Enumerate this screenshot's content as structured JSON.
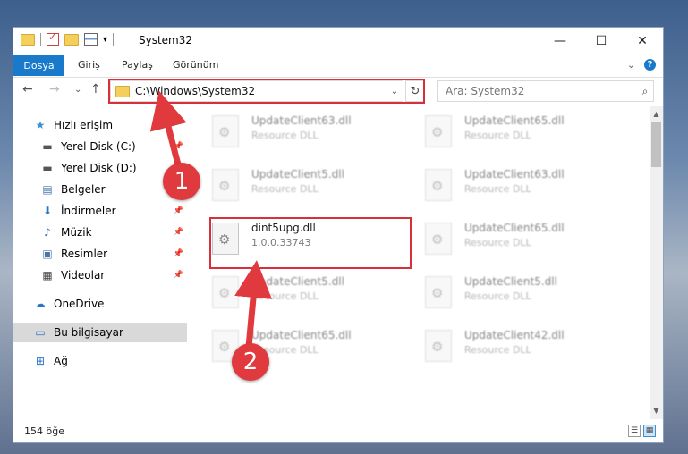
{
  "window": {
    "title": "System32",
    "caption": {
      "minimize": "—",
      "maximize": "☐",
      "close": "✕"
    }
  },
  "quick_access_toolbar": {
    "dropdown": "▾"
  },
  "ribbon": {
    "tabs": [
      "Dosya",
      "Giriş",
      "Paylaş",
      "Görünüm"
    ],
    "collapse": "⌄",
    "help": "?"
  },
  "nav": {
    "back": "←",
    "forward": "→",
    "recent": "⌄",
    "up": "↑"
  },
  "address": {
    "path": "C:\\Windows\\System32",
    "dropdown": "⌄",
    "refresh": "↻"
  },
  "search": {
    "placeholder": "Ara: System32",
    "icon": "⌕"
  },
  "sidebar": {
    "items": [
      {
        "label": "Hızlı erişim",
        "icon": "star-icon",
        "glyph": "★",
        "color": "#3c8fd9"
      },
      {
        "label": "Yerel Disk (C:)",
        "icon": "drive-icon",
        "glyph": "▬",
        "color": "#555555"
      },
      {
        "label": "Yerel Disk (D:)",
        "icon": "drive-icon",
        "glyph": "▬",
        "color": "#555555"
      },
      {
        "label": "Belgeler",
        "icon": "documents-icon",
        "glyph": "▤",
        "color": "#4b74a8"
      },
      {
        "label": "İndirmeler",
        "icon": "download-icon",
        "glyph": "⬇",
        "color": "#2a74c8"
      },
      {
        "label": "Müzik",
        "icon": "music-icon",
        "glyph": "♪",
        "color": "#2a74c8"
      },
      {
        "label": "Resimler",
        "icon": "pictures-icon",
        "glyph": "▣",
        "color": "#4b74a8"
      },
      {
        "label": "Videolar",
        "icon": "videos-icon",
        "glyph": "▦",
        "color": "#444444"
      },
      {
        "label": "OneDrive",
        "icon": "cloud-icon",
        "glyph": "☁",
        "color": "#2a74c8"
      },
      {
        "label": "Bu bilgisayar",
        "icon": "computer-icon",
        "glyph": "▭",
        "color": "#2a74c8"
      },
      {
        "label": "Ağ",
        "icon": "network-icon",
        "glyph": "⊞",
        "color": "#2a74c8"
      }
    ],
    "pin": "📌"
  },
  "files": [
    {
      "name": "UpdateClient63.dll",
      "sub": "Resource DLL"
    },
    {
      "name": "UpdateClient65.dll",
      "sub": "Resource DLL"
    },
    {
      "name": "UpdateClient5.dll",
      "sub": "Resource DLL"
    },
    {
      "name": "UpdateClient63.dll",
      "sub": "Resource DLL"
    },
    {
      "name": "dint5upg.dll",
      "sub": "1.0.0.33743"
    },
    {
      "name": "UpdateClient65.dll",
      "sub": "Resource DLL"
    },
    {
      "name": "UpdateClient5.dll",
      "sub": "Resource DLL"
    },
    {
      "name": "UpdateClient5.dll",
      "sub": "Resource DLL"
    },
    {
      "name": "UpdateClient65.dll",
      "sub": "Resource DLL"
    },
    {
      "name": "UpdateClient42.dll",
      "sub": "Resource DLL"
    }
  ],
  "status": {
    "count": "154 öğe"
  },
  "view_buttons": {
    "details": "☰",
    "tiles": "▦"
  },
  "annotations": {
    "step1": "1",
    "step2": "2",
    "color": "#e0393e"
  }
}
